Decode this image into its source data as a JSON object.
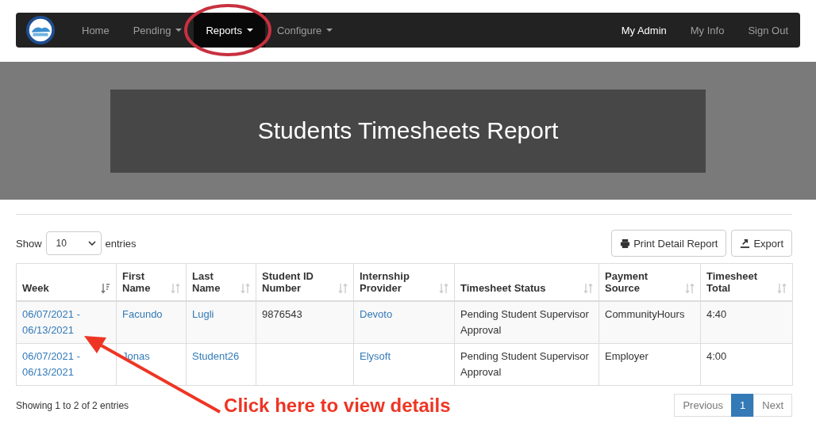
{
  "navbar": {
    "items": [
      {
        "label": "Home",
        "dropdown": false,
        "selected": false,
        "circled": false
      },
      {
        "label": "Pending",
        "dropdown": true,
        "selected": false,
        "circled": false
      },
      {
        "label": "Reports",
        "dropdown": true,
        "selected": true,
        "circled": true
      },
      {
        "label": "Configure",
        "dropdown": true,
        "selected": false,
        "circled": false
      }
    ],
    "right_items": [
      {
        "label": "My Admin",
        "selected": true
      },
      {
        "label": "My Info",
        "selected": false
      },
      {
        "label": "Sign Out",
        "selected": false
      }
    ]
  },
  "banner": {
    "title": "Students Timesheets Report"
  },
  "length_menu": {
    "before": "Show",
    "value": "10",
    "after": "entries"
  },
  "buttons": [
    {
      "label": "Print Detail Report",
      "kind": "print"
    },
    {
      "label": "Export",
      "kind": "export"
    }
  ],
  "table": {
    "columns": [
      {
        "label": "Week",
        "sorted": true,
        "link": true
      },
      {
        "label": "First Name",
        "sorted": false,
        "link": true
      },
      {
        "label": "Last Name",
        "sorted": false,
        "link": true
      },
      {
        "label": "Student ID Number",
        "sorted": false,
        "link": false
      },
      {
        "label": "Internship Provider",
        "sorted": false,
        "link": true
      },
      {
        "label": "Timesheet Status",
        "sorted": false,
        "link": false
      },
      {
        "label": "Payment Source",
        "sorted": false,
        "link": false
      },
      {
        "label": "Timesheet Total",
        "sorted": false,
        "link": false
      }
    ],
    "rows": [
      [
        "06/07/2021 - 06/13/2021",
        "Facundo",
        "Lugli",
        "9876543",
        "Devoto",
        "Pending Student Supervisor Approval",
        "CommunityHours",
        "4:40"
      ],
      [
        "06/07/2021 - 06/13/2021",
        "Jonas",
        "Student26",
        "",
        "Elysoft",
        "Pending Student Supervisor Approval",
        "Employer",
        "4:00"
      ]
    ]
  },
  "info": "Showing 1 to 2 of 2 entries",
  "pagination": [
    {
      "label": "Previous",
      "selected": false
    },
    {
      "label": "1",
      "selected": true
    },
    {
      "label": "Next",
      "selected": false
    }
  ],
  "annotation": {
    "text": "Click here to view details"
  }
}
